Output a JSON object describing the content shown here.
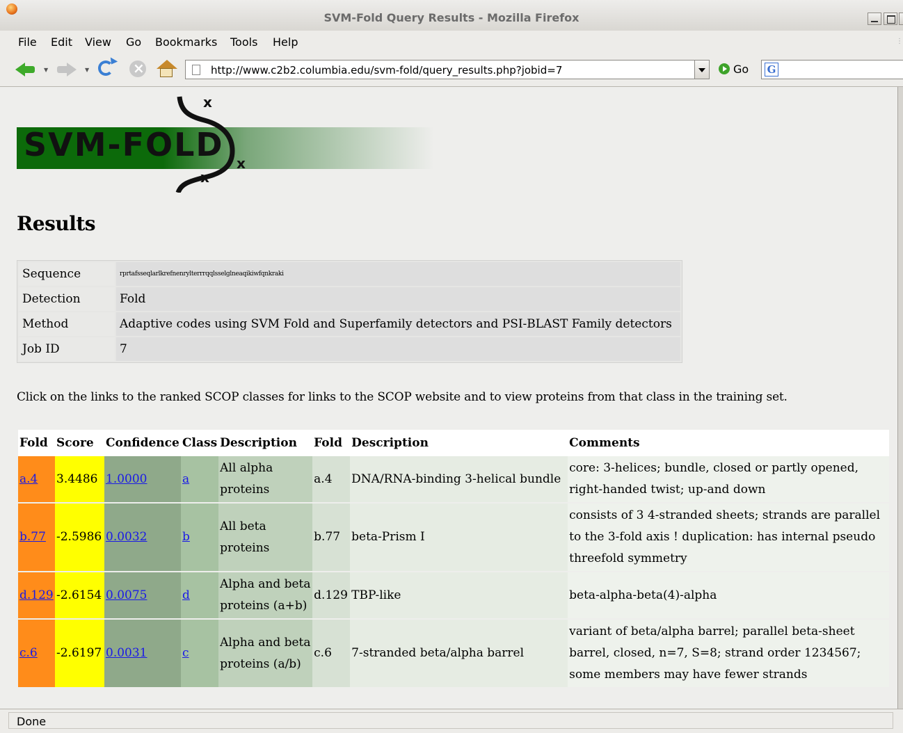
{
  "window": {
    "title": "SVM-Fold Query Results - Mozilla Firefox"
  },
  "menu": {
    "items": [
      {
        "label": "File"
      },
      {
        "label": "Edit"
      },
      {
        "label": "View"
      },
      {
        "label": "Go"
      },
      {
        "label": "Bookmarks"
      },
      {
        "label": "Tools"
      },
      {
        "label": "Help"
      }
    ]
  },
  "toolbar": {
    "url": "http://www.c2b2.columbia.edu/svm-fold/query_results.php?jobid=7",
    "go_label": "Go",
    "search_icon": "G"
  },
  "logo": {
    "text": "SVM-FOLD",
    "x_mark": "x"
  },
  "page": {
    "heading": "Results",
    "instruction": "Click on the links to the ranked SCOP classes for links to the SCOP website and to view proteins from that class in the training set."
  },
  "info": {
    "rows": [
      {
        "key": "Sequence",
        "value": "rprtafsseqlarlkrefnenrylterrrqqlsselglneaqikiwfqnkraki"
      },
      {
        "key": "Detection",
        "value": "Fold"
      },
      {
        "key": "Method",
        "value": "Adaptive codes using SVM Fold and Superfamily detectors and PSI-BLAST Family detectors"
      },
      {
        "key": "Job ID",
        "value": "7"
      }
    ]
  },
  "results": {
    "headers": [
      "Fold",
      "Score",
      "Confidence",
      "Class",
      "Description",
      "Fold",
      "Description",
      "Comments"
    ],
    "rows": [
      {
        "fold": "a.4",
        "score": "3.4486",
        "confidence": "1.0000",
        "class": "a",
        "class_desc": "All alpha proteins",
        "fold2": "a.4",
        "fold_desc": "DNA/RNA-binding 3-helical bundle",
        "comments": "core: 3-helices; bundle, closed or partly opened, right-handed twist; up-and down"
      },
      {
        "fold": "b.77",
        "score": "-2.5986",
        "confidence": "0.0032",
        "class": "b",
        "class_desc": "All beta proteins",
        "fold2": "b.77",
        "fold_desc": "beta-Prism I",
        "comments": "consists of 3 4-stranded sheets; strands are parallel to the 3-fold axis ! duplication: has internal pseudo threefold symmetry"
      },
      {
        "fold": "d.129",
        "score": "-2.6154",
        "confidence": "0.0075",
        "class": "d",
        "class_desc": "Alpha and beta proteins (a+b)",
        "fold2": "d.129",
        "fold_desc": "TBP-like",
        "comments": "beta-alpha-beta(4)-alpha"
      },
      {
        "fold": "c.6",
        "score": "-2.6197",
        "confidence": "0.0031",
        "class": "c",
        "class_desc": "Alpha and beta proteins (a/b)",
        "fold2": "c.6",
        "fold_desc": "7-stranded beta/alpha barrel",
        "comments": "variant of beta/alpha barrel; parallel beta-sheet barrel, closed, n=7, S=8; strand order 1234567; some members may have fewer strands"
      }
    ]
  },
  "status": {
    "text": "Done"
  },
  "colors": {
    "fold_col": "#ff8c1a",
    "score_col": "#ffff00",
    "confidence_col": "#8fa98a",
    "class_col": "#a7c2a2",
    "logo_green": "#0c6a0a",
    "link": "#1a1ae6"
  }
}
